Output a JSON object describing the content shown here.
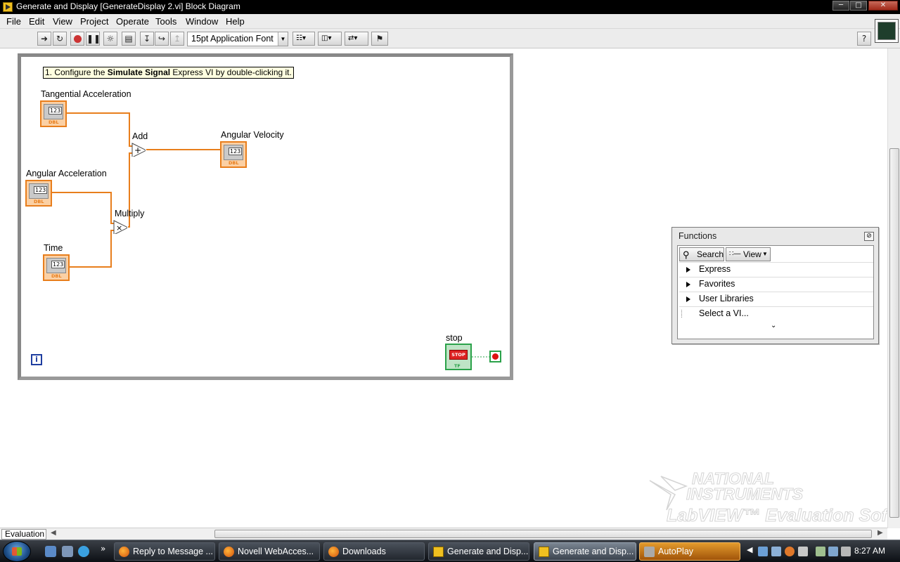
{
  "window": {
    "title": "Generate and Display [GenerateDisplay 2.vi] Block Diagram"
  },
  "menu": [
    "File",
    "Edit",
    "View",
    "Project",
    "Operate",
    "Tools",
    "Window",
    "Help"
  ],
  "toolbar": {
    "font": "15pt Application Font",
    "buttons": [
      "run-arrow-icon",
      "run-continuously-icon",
      "abort-icon",
      "pause-icon",
      "highlight-execution-icon",
      "retain-wire-values-icon",
      "step-into-icon",
      "step-over-icon",
      "step-out-icon",
      "align-icon",
      "distribute-icon",
      "reorder-icon",
      "cleanup-diagram-icon",
      "help-icon"
    ]
  },
  "diagram": {
    "comment_prefix": "1. Configure the ",
    "comment_bold": "Simulate Signal",
    "comment_suffix": " Express VI by double-clicking it.",
    "labels": {
      "tangential": "Tangential Acceleration",
      "angular_accel": "Angular Acceleration",
      "time": "Time",
      "add": "Add",
      "multiply": "Multiply",
      "angular_velocity": "Angular Velocity",
      "stop": "stop"
    },
    "terminal_num": "123",
    "terminal_type": "DBL",
    "stop_button": "STOP",
    "stop_type": "TF",
    "iteration": "i",
    "add_symbol": "+",
    "multiply_symbol": "×",
    "wire_color": "#e87e1c",
    "bool_color": "#2ba24a"
  },
  "palette": {
    "title": "Functions",
    "search": "Search",
    "view": "View",
    "items": [
      "Express",
      "Favorites",
      "User Libraries",
      "Select a VI..."
    ]
  },
  "status": {
    "tab": "Evaluation"
  },
  "watermark": {
    "line1": "NATIONAL",
    "line2": "INSTRUMENTS",
    "line3": "LabVIEW™ Evaluation Software"
  },
  "taskbar": {
    "tasks": [
      "Reply to Message ...",
      "Novell WebAcces...",
      "Downloads",
      "Generate and Disp...",
      "Generate and Disp...",
      "AutoPlay"
    ],
    "clock": "8:27 AM"
  }
}
